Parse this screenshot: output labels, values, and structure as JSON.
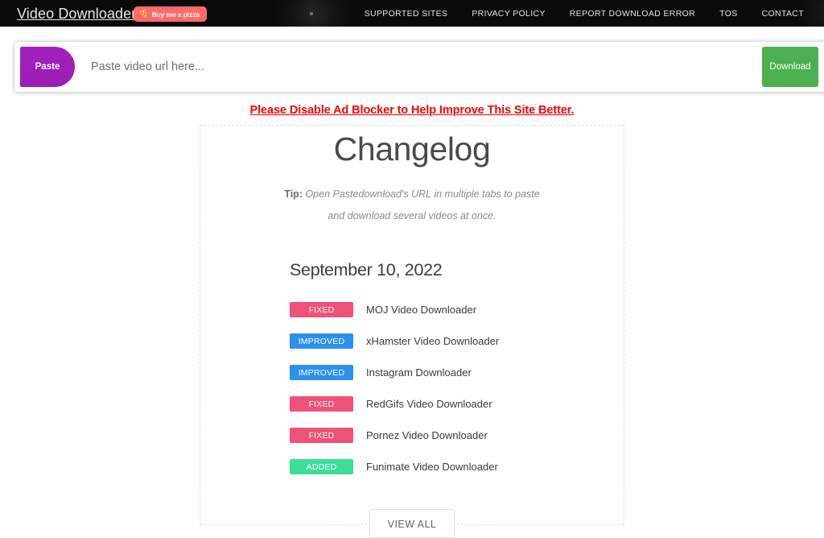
{
  "header": {
    "brand": "Video Downloader",
    "pizza_button": {
      "label": "Buy me a pizza",
      "icon": "pizza-icon",
      "color": "#ff6b6b"
    },
    "nav_links": [
      {
        "label": "SUPPORTED SITES"
      },
      {
        "label": "PRIVACY POLICY"
      },
      {
        "label": "REPORT DOWNLOAD ERROR"
      },
      {
        "label": "TOS"
      },
      {
        "label": "CONTACT"
      }
    ],
    "background": "#0a0a0a"
  },
  "search": {
    "paste_label": "Paste",
    "paste_color": "#a020b8",
    "input_value": "",
    "placeholder": "Paste video url here...",
    "download_label": "Download",
    "download_color": "#4caf50"
  },
  "notice": {
    "text": "Please Disable Ad Blocker to Help Improve This Site Better.",
    "color": "#ff0000"
  },
  "changelog": {
    "title": "Changelog",
    "tip_prefix": "Tip:",
    "tip_text": " Open Pastedownload's URL in multiple tabs to paste and download several videos at once.",
    "date": "September 10, 2022",
    "entries": [
      {
        "badge": "FIXED",
        "type": "fixed",
        "label": "MOJ Video Downloader",
        "color": "#ef5276"
      },
      {
        "badge": "IMPROVED",
        "type": "improved",
        "label": "xHamster Video Downloader",
        "color": "#2b90ef"
      },
      {
        "badge": "IMPROVED",
        "type": "improved",
        "label": "Instagram Downloader",
        "color": "#2b90ef"
      },
      {
        "badge": "FIXED",
        "type": "fixed",
        "label": "RedGifs Video Downloader",
        "color": "#ef5276"
      },
      {
        "badge": "FIXED",
        "type": "fixed",
        "label": "Pornez Video Downloader",
        "color": "#ef5276"
      },
      {
        "badge": "ADDED",
        "type": "added",
        "label": "Funimate Video Downloader",
        "color": "#3ddc97"
      }
    ],
    "view_all_label": "VIEW ALL"
  }
}
